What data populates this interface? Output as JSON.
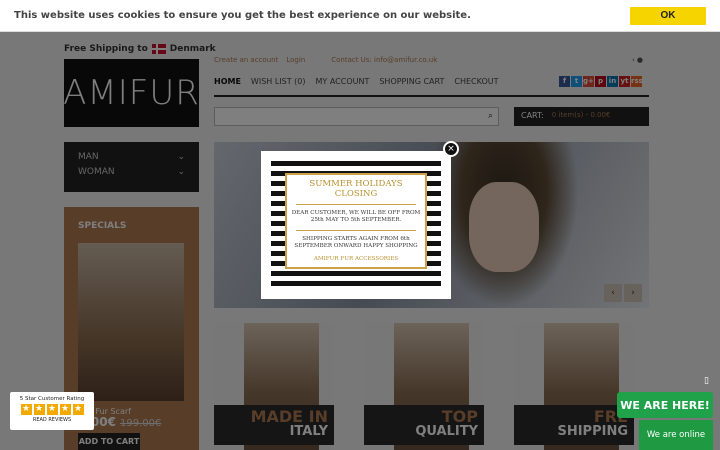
{
  "cookie": {
    "text": "This website uses cookies to ensure you get the best experience on our website.",
    "ok_label": "OK"
  },
  "header": {
    "shipping": "Free Shipping to",
    "country": "Denmark",
    "logo": "AMIFUR",
    "links": {
      "create_account": "Create an account",
      "login": "Login",
      "contact": "Contact Us: info@amifur.co.uk"
    },
    "nav": [
      "HOME",
      "WISH LIST (0)",
      "MY ACCOUNT",
      "SHOPPING CART",
      "CHECKOUT"
    ],
    "social": [
      "f",
      "t",
      "g+",
      "p",
      "in",
      "yt",
      "rss"
    ],
    "cart_label": "CART:",
    "cart_items": "0 item(s) - 0.00€"
  },
  "sidebar": {
    "categories": [
      "MAN",
      "WOMAN"
    ],
    "specials_title": "SPECIALS",
    "special_name": "oon Fur Scarf",
    "special_price": "9.00€",
    "special_old_price": "199.00€",
    "add_to_cart": "ADD TO CART"
  },
  "tiles": [
    {
      "line1": "MADE IN",
      "line2": "ITALY"
    },
    {
      "line1": "TOP",
      "line2": "QUALITY"
    },
    {
      "line1": "FRE",
      "line2": "SHIPPING"
    }
  ],
  "modal": {
    "title": "SUMMER HOLIDAYS CLOSING",
    "text1": "DEAR CUSTOMER, WE WILL BE OFF FROM 25th MAY TO 5th SEPTEMBER.",
    "text2": "SHIPPING STARTS AGAIN FROM 6th SEPTEMBER ONWARD HAPPY SHOPPING",
    "brand": "AMIFUR FUR ACCESSORIES",
    "close": "×"
  },
  "rating": {
    "title": "5 Star Customer Rating",
    "reviews": "READ REVIEWS"
  },
  "chat": {
    "here": "WE ARE HERE!",
    "online": "We are online"
  },
  "colors": {
    "accent": "#b07a52",
    "cookie_button": "#f5d400",
    "chat": "#1fa24a"
  }
}
